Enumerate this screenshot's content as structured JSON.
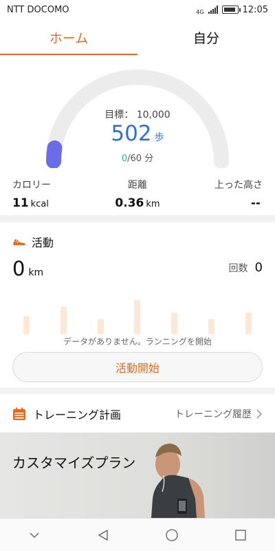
{
  "status_bar": {
    "carrier": "NTT DOCOMO",
    "network": "4G",
    "time": "12:05"
  },
  "tabs": [
    {
      "label": "ホーム",
      "active": true
    },
    {
      "label": "自分",
      "active": false
    }
  ],
  "steps_card": {
    "goal_label": "目標： 10,000",
    "steps_value": "502",
    "steps_unit": "歩",
    "minutes_done": "0",
    "minutes_rest": "/60 分",
    "progress_fraction": 0.05,
    "stats": [
      {
        "label": "カロリー",
        "value": "11",
        "unit": "kcal"
      },
      {
        "label": "距離",
        "value": "0.36",
        "unit": "km"
      },
      {
        "label": "上った高さ",
        "value": "--",
        "unit": ""
      }
    ]
  },
  "activity_card": {
    "title": "活動",
    "distance_value": "0",
    "distance_unit": "km",
    "count_label": "回数",
    "count_value": "0",
    "no_data_text": "データがありません。ランニングを開始",
    "start_button": "活動開始"
  },
  "training_card": {
    "title": "トレーニング計画",
    "history_link": "トレーニング履歴"
  },
  "banner": {
    "title": "カスタマイズプラン"
  },
  "colors": {
    "accent": "#e8691e",
    "steps_blue": "#2d6fe0",
    "gauge_track": "#ececec",
    "gauge_fill": "#6b6de8",
    "minutes_green": "#24b3a0"
  },
  "icons": {
    "activity": "running-shoe-icon",
    "training": "calendar-icon",
    "history": "chevron-right-icon",
    "nav": [
      "chevron-down-icon",
      "back-triangle-icon",
      "home-circle-icon",
      "recents-square-icon"
    ]
  }
}
